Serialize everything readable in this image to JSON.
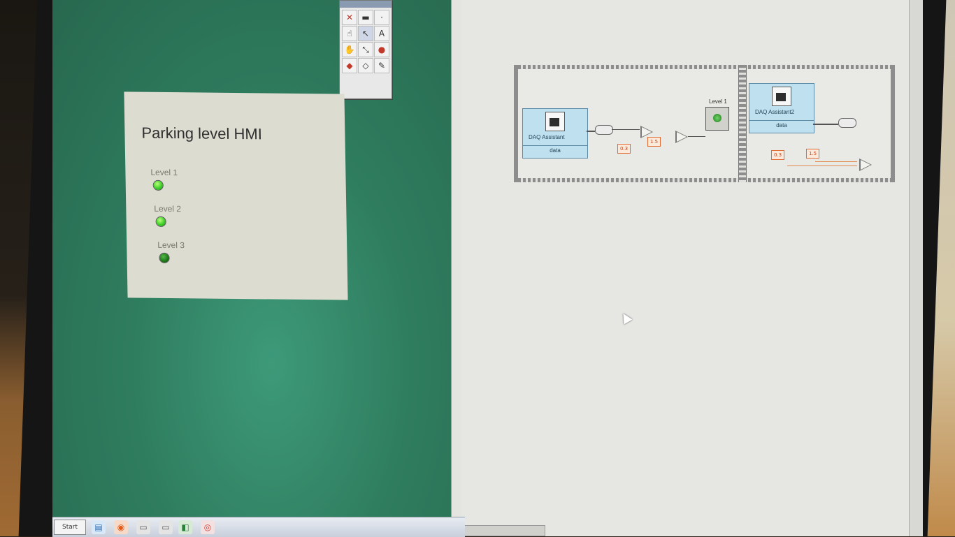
{
  "front_panel": {
    "title": "Parking level HMI",
    "leds": [
      {
        "label": "Level 1",
        "state": "on"
      },
      {
        "label": "Level 2",
        "state": "on"
      },
      {
        "label": "Level 3",
        "state": "dim"
      }
    ]
  },
  "block_diagram": {
    "daq_assistants": [
      {
        "name": "DAQ Assistant",
        "output": "data"
      },
      {
        "name": "DAQ Assistant2",
        "output": "data"
      }
    ],
    "constants": [
      "0.3",
      "1.5",
      "0.3",
      "1.5"
    ],
    "indicator_label": "Level 1"
  },
  "taskbar": {
    "start_label": "Start"
  },
  "colors": {
    "front_panel_bg": "#2f7d5f",
    "led_on": "#3fcf2a",
    "daq_block": "#bfe0ee",
    "constant_border": "#e06b35"
  }
}
